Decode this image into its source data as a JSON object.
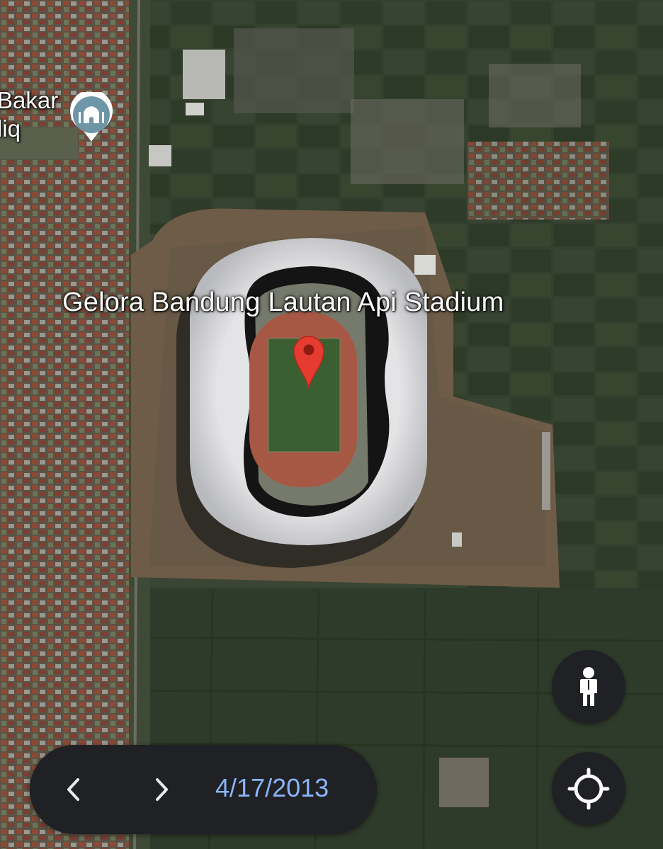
{
  "map": {
    "type": "satellite",
    "selected_place": {
      "label": "Gelora Bandung Lautan Api Stadium",
      "icon": "red-location-pin-icon"
    },
    "poi": {
      "label_line1": "Bakar",
      "label_line2": "liq",
      "icon": "mosque-icon"
    }
  },
  "controls": {
    "street_view_icon": "pegman-icon",
    "my_location_icon": "crosshair-icon"
  },
  "timeline": {
    "prev_icon": "chevron-left-icon",
    "next_icon": "chevron-right-icon",
    "date": "4/17/2013",
    "date_color": "#8ab4f8"
  }
}
